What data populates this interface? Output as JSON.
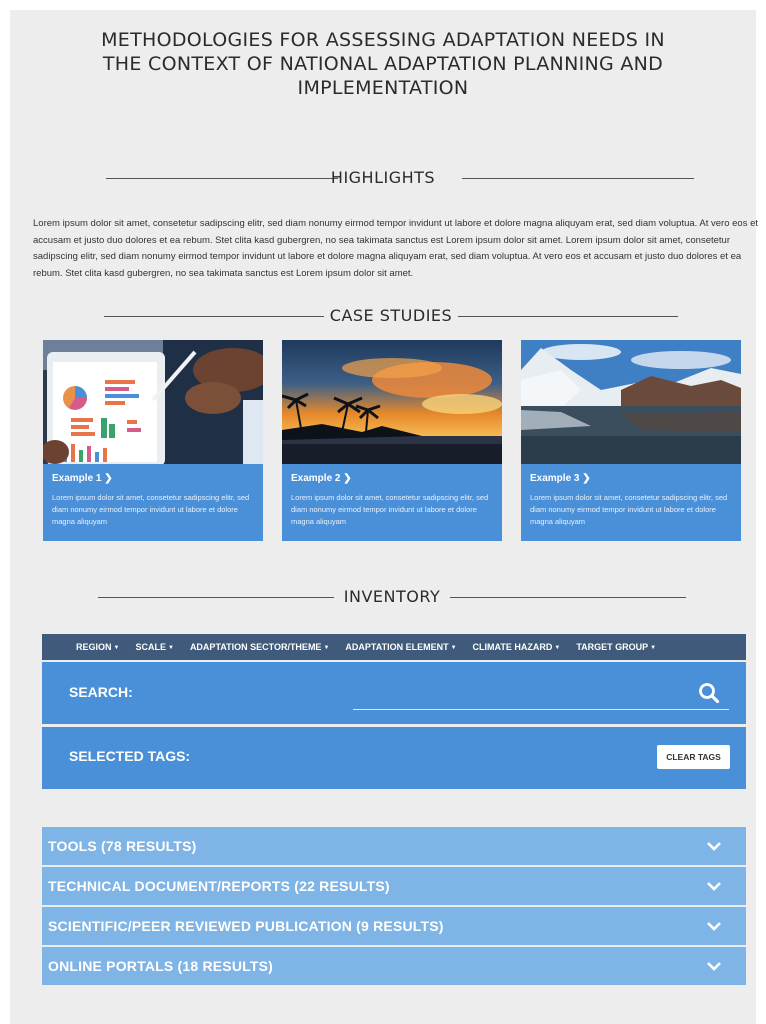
{
  "title_lines": [
    "METHODOLOGIES FOR ASSESSING ADAPTATION NEEDS IN",
    "THE CONTEXT OF NATIONAL ADAPTATION PLANNING AND",
    "IMPLEMENTATION"
  ],
  "highlights": {
    "heading": "HIGHLIGHTS",
    "text": "Lorem ipsum dolor sit amet, consetetur sadipscing elitr, sed diam nonumy eirmod tempor invidunt ut labore et dolore magna aliquyam erat, sed diam voluptua. At vero eos et accusam et justo duo dolores et ea rebum. Stet clita kasd gubergren, no sea takimata sanctus est Lorem ipsum dolor sit amet. Lorem ipsum dolor sit amet, consetetur sadipscing elitr, sed diam nonumy eirmod tempor invidunt ut labore et dolore magna aliquyam erat, sed diam voluptua. At vero eos et accusam et justo duo dolores et ea rebum. Stet clita kasd gubergren, no sea takimata sanctus est Lorem ipsum dolor sit amet."
  },
  "case_studies": {
    "heading": "CASE STUDIES",
    "cards": [
      {
        "title": "Example 1",
        "text": "Lorem ipsum dolor sit amet, consetetur sadipscing elitr, sed diam nonumy eirmod tempor invidunt ut labore et dolore magna aliquyam",
        "icon": "chevron-right-icon"
      },
      {
        "title": "Example 2",
        "text": "Lorem ipsum dolor sit amet, consetetur sadipscing elitr, sed diam nonumy eirmod tempor invidunt ut labore et dolore magna aliquyam",
        "icon": "chevron-right-icon"
      },
      {
        "title": "Example 3",
        "text": "Lorem ipsum dolor sit amet, consetetur sadipscing elitr, sed diam nonumy eirmod tempor invidunt ut labore et dolore magna aliquyam",
        "icon": "chevron-right-icon"
      }
    ]
  },
  "inventory": {
    "heading": "INVENTORY",
    "filters": [
      "REGION",
      "SCALE",
      "ADAPTATION SECTOR/THEME",
      "ADAPTATION ELEMENT",
      "CLIMATE HAZARD",
      "TARGET GROUP"
    ],
    "search_label": "SEARCH:",
    "search_value": "",
    "selected_tags_label": "SELECTED TAGS:",
    "clear_tags_label": "CLEAR TAGS",
    "results": [
      "TOOLS (78 RESULTS)",
      "TECHNICAL DOCUMENT/REPORTS (22 RESULTS)",
      "SCIENTIFIC/PEER REVIEWED PUBLICATION (9 RESULTS)",
      "ONLINE PORTALS (18 RESULTS)"
    ]
  },
  "colors": {
    "accent_blue": "#4a90d9",
    "light_blue": "#7eb4e6",
    "nav_dark": "#3f5a7a",
    "page_bg": "#ededed"
  }
}
